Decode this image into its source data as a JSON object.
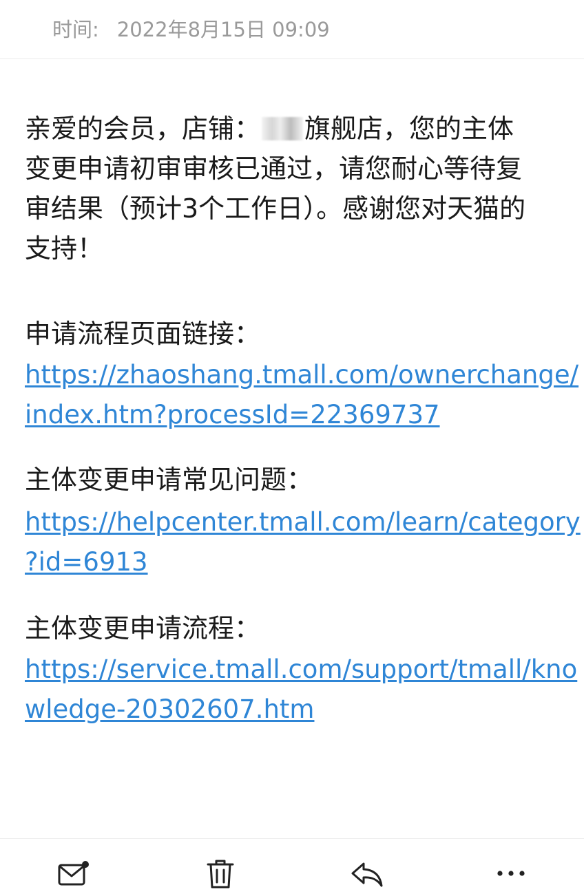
{
  "header": {
    "time_label": "时间:",
    "time_value": "2022年8月15日 09:09"
  },
  "body": {
    "greeting_lines": [
      [
        "亲爱的会员，店铺：",
        "旗舰店，您的主体"
      ],
      "变更申请初审审核已通过，请您耐心等待复",
      "审结果（预计3个工作日）。感谢您对天猫的",
      "支持！"
    ],
    "sections": [
      {
        "label": "申请流程页面链接：",
        "link_lines": [
          "https://zhaoshang.tmall.com/ownerchange/",
          "index.htm?processId=22369737"
        ]
      },
      {
        "label": "主体变更申请常见问题：",
        "link_lines": [
          "https://helpcenter.tmall.com/learn/category",
          "?id=6913"
        ]
      },
      {
        "label": "主体变更申请流程：",
        "link_lines": [
          "https://service.tmall.com/support/tmall/kno",
          "wledge-20302607.htm"
        ]
      }
    ]
  },
  "toolbar": {
    "icons": [
      "mark-unread-icon",
      "delete-icon",
      "reply-icon",
      "more-icon"
    ]
  }
}
